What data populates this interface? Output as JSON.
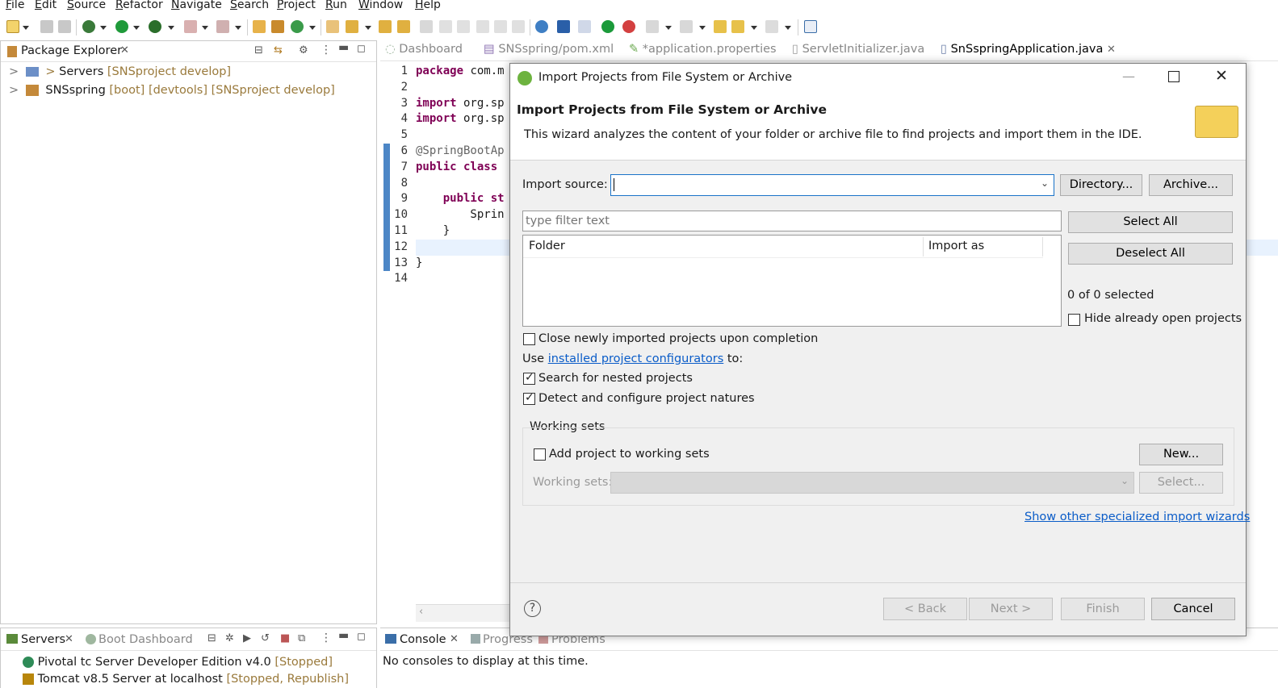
{
  "menu": [
    "File",
    "Edit",
    "Source",
    "Refactor",
    "Navigate",
    "Search",
    "Project",
    "Run",
    "Window",
    "Help"
  ],
  "package_explorer": {
    "title": "Package Explorer",
    "items": [
      {
        "arrow": ">",
        "prefix": ">",
        "name": "Servers",
        "decoration": "[SNSproject develop]"
      },
      {
        "arrow": ">",
        "name": "SNSspring",
        "decoration": "[boot] [devtools] [SNSproject develop]"
      }
    ]
  },
  "editor": {
    "tabs": [
      "Dashboard",
      "SNSspring/pom.xml",
      "*application.properties",
      "ServletInitializer.java",
      "SnSspringApplication.java"
    ],
    "lines": [
      {
        "n": "1",
        "kw": "package",
        "rest": " com.m"
      },
      {
        "n": "2",
        "kw": "",
        "rest": ""
      },
      {
        "n": "3",
        "kw": "import",
        "rest": " org.sp"
      },
      {
        "n": "4",
        "kw": "import",
        "rest": " org.sp"
      },
      {
        "n": "5",
        "kw": "",
        "rest": ""
      },
      {
        "n": "6",
        "kw": "",
        "rest": "@SpringBootAp"
      },
      {
        "n": "7",
        "kw": "public class",
        "rest": ""
      },
      {
        "n": "8",
        "kw": "",
        "rest": ""
      },
      {
        "n": "9",
        "kw": "    public st",
        "rest": ""
      },
      {
        "n": "10",
        "kw": "",
        "rest": "        Sprin"
      },
      {
        "n": "11",
        "kw": "",
        "rest": "    }"
      },
      {
        "n": "12",
        "kw": "",
        "rest": ""
      },
      {
        "n": "13",
        "kw": "",
        "rest": "}"
      },
      {
        "n": "14",
        "kw": "",
        "rest": ""
      }
    ]
  },
  "servers_panel": {
    "tabs": [
      "Servers",
      "Boot Dashboard"
    ],
    "rows": [
      {
        "name": "Pivotal tc Server Developer Edition v4.0",
        "status": "[Stopped]"
      },
      {
        "name": "Tomcat v8.5 Server at localhost",
        "status": "[Stopped, Republish]"
      }
    ]
  },
  "console_panel": {
    "tabs": [
      "Console",
      "Progress",
      "Problems"
    ],
    "message": "No consoles to display at this time."
  },
  "dialog": {
    "window_title": "Import Projects from File System or Archive",
    "header_title": "Import Projects from File System or Archive",
    "header_desc": "This wizard analyzes the content of your folder or archive file to find projects and import them in the IDE.",
    "import_source_label": "Import source:",
    "import_source_value": "",
    "directory_button": "Directory...",
    "archive_button": "Archive...",
    "filter_placeholder": "type filter text",
    "table_columns": [
      "Folder",
      "Import as"
    ],
    "select_all": "Select All",
    "deselect_all": "Deselect All",
    "selected_count": "0 of 0 selected",
    "hide_open_projects": "Hide already open projects",
    "close_newly_imported": "Close newly imported projects upon completion",
    "use_prefix": "Use ",
    "configurators_link": "installed project configurators",
    "use_suffix": " to:",
    "search_nested": "Search for nested projects",
    "detect_natures": "Detect and configure project natures",
    "working_sets_group": "Working sets",
    "add_to_working_sets": "Add project to working sets",
    "new_button": "New...",
    "working_sets_label": "Working sets:",
    "select_button": "Select...",
    "other_wizards_link": "Show other specialized import wizards",
    "back_button": "< Back",
    "next_button": "Next >",
    "finish_button": "Finish",
    "cancel_button": "Cancel",
    "help_symbol": "?"
  },
  "colors": {
    "link": "#0a5cc8",
    "keyword": "#7f0055",
    "decoration": "#9a7a3c"
  }
}
